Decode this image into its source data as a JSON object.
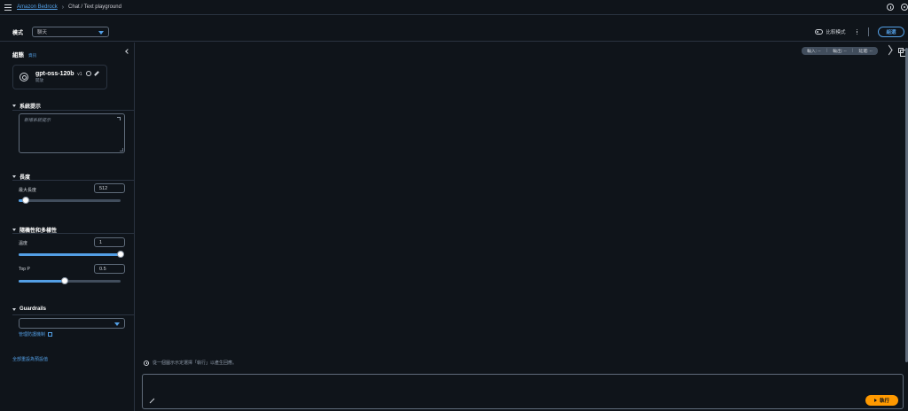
{
  "breadcrumb": {
    "root": "Amazon Bedrock",
    "current": "Chat / Text playground"
  },
  "topbar": {
    "icons": [
      "gear-icon",
      "info-icon"
    ]
  },
  "modebar": {
    "mode_label": "模式",
    "mode_value": "聊天",
    "compare_label": "比較模式",
    "update_label": "組選"
  },
  "sidebar": {
    "title": "組態",
    "info_link": "資訊",
    "model": {
      "name": "gpt-oss-120b",
      "version": "v1",
      "provider": "開放"
    },
    "system_prompt": {
      "title": "系統提示",
      "placeholder": "新增系統提示"
    },
    "length": {
      "title": "長度",
      "max_label": "最大長度",
      "max_value": "512",
      "max_fraction": 0.07
    },
    "randomness": {
      "title": "隨機性和多樣性",
      "temp_label": "溫度",
      "temp_value": "1",
      "temp_fraction": 1.0,
      "topp_label": "Top P",
      "topp_value": "0.5",
      "topp_fraction": 0.45
    },
    "guardrails": {
      "title": "Guardrails",
      "manage_link": "管理防護機制"
    },
    "reset_link": "全部重設為預設值"
  },
  "main": {
    "metrics": {
      "input": "輸入: --",
      "output": "輸出: --",
      "latency": "延遲: --"
    },
    "hint": "從一個圖示示定選擇「執行」以產生回應。",
    "run_label": "執行"
  },
  "colors": {
    "accent": "#539fe5",
    "run": "#ff9900",
    "background": "#0f141a"
  }
}
